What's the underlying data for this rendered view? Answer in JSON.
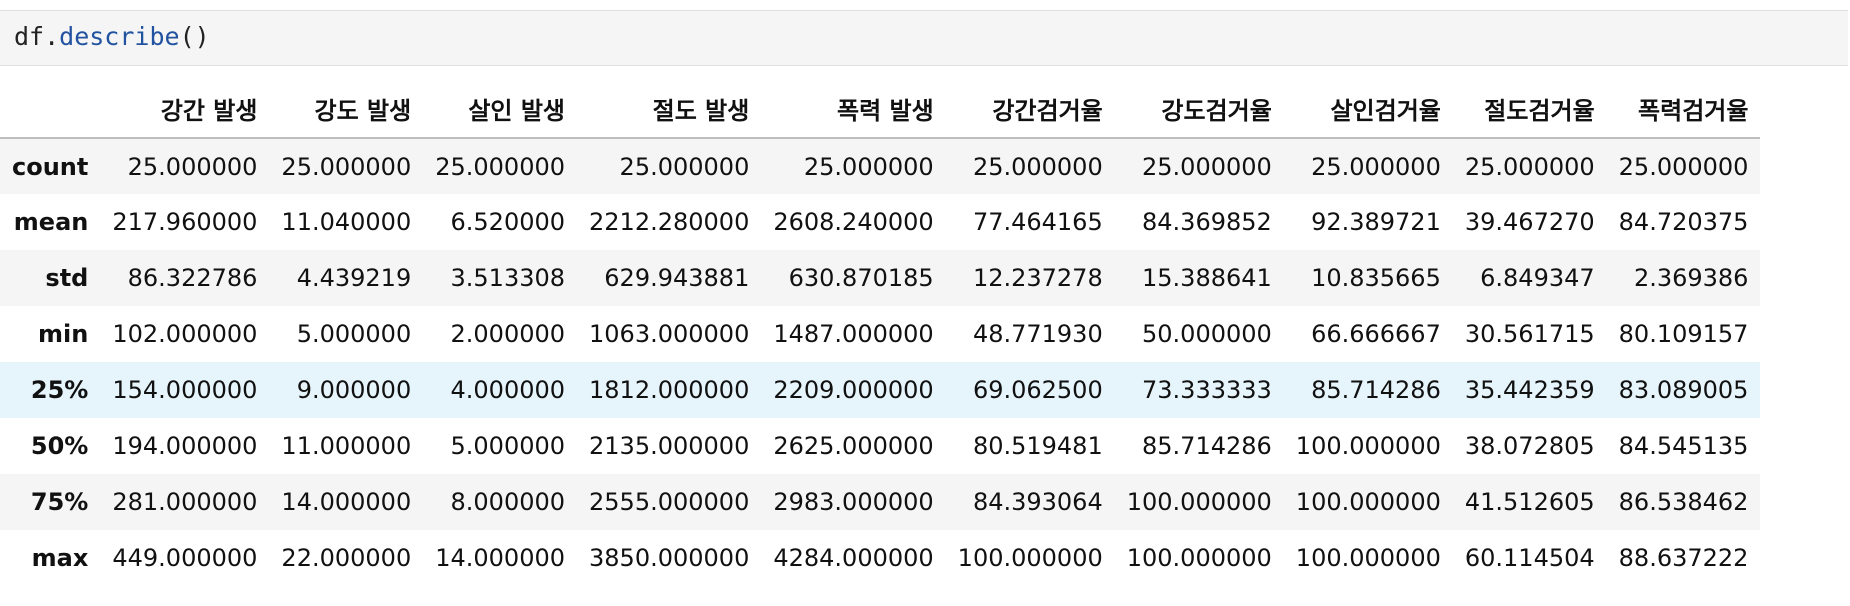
{
  "code_cell": {
    "prefix": "df.",
    "function": "describe",
    "suffix": "()"
  },
  "table": {
    "columns": [
      "강간 발생",
      "강도 발생",
      "살인 발생",
      "절도 발생",
      "폭력 발생",
      "강간검거율",
      "강도검거율",
      "살인검거율",
      "절도검거율",
      "폭력검거율"
    ],
    "rows": [
      {
        "label": "count",
        "values": [
          "25.000000",
          "25.000000",
          "25.000000",
          "25.000000",
          "25.000000",
          "25.000000",
          "25.000000",
          "25.000000",
          "25.000000",
          "25.000000"
        ]
      },
      {
        "label": "mean",
        "values": [
          "217.960000",
          "11.040000",
          "6.520000",
          "2212.280000",
          "2608.240000",
          "77.464165",
          "84.369852",
          "92.389721",
          "39.467270",
          "84.720375"
        ]
      },
      {
        "label": "std",
        "values": [
          "86.322786",
          "4.439219",
          "3.513308",
          "629.943881",
          "630.870185",
          "12.237278",
          "15.388641",
          "10.835665",
          "6.849347",
          "2.369386"
        ]
      },
      {
        "label": "min",
        "values": [
          "102.000000",
          "5.000000",
          "2.000000",
          "1063.000000",
          "1487.000000",
          "48.771930",
          "50.000000",
          "66.666667",
          "30.561715",
          "80.109157"
        ]
      },
      {
        "label": "25%",
        "values": [
          "154.000000",
          "9.000000",
          "4.000000",
          "1812.000000",
          "2209.000000",
          "69.062500",
          "73.333333",
          "85.714286",
          "35.442359",
          "83.089005"
        ]
      },
      {
        "label": "50%",
        "values": [
          "194.000000",
          "11.000000",
          "5.000000",
          "2135.000000",
          "2625.000000",
          "80.519481",
          "85.714286",
          "100.000000",
          "38.072805",
          "84.545135"
        ]
      },
      {
        "label": "75%",
        "values": [
          "281.000000",
          "14.000000",
          "8.000000",
          "2555.000000",
          "2983.000000",
          "84.393064",
          "100.000000",
          "100.000000",
          "41.512605",
          "86.538462"
        ]
      },
      {
        "label": "max",
        "values": [
          "449.000000",
          "22.000000",
          "14.000000",
          "3850.000000",
          "4284.000000",
          "100.000000",
          "100.000000",
          "100.000000",
          "60.114504",
          "88.637222"
        ]
      }
    ],
    "hovered_row": "25%"
  }
}
